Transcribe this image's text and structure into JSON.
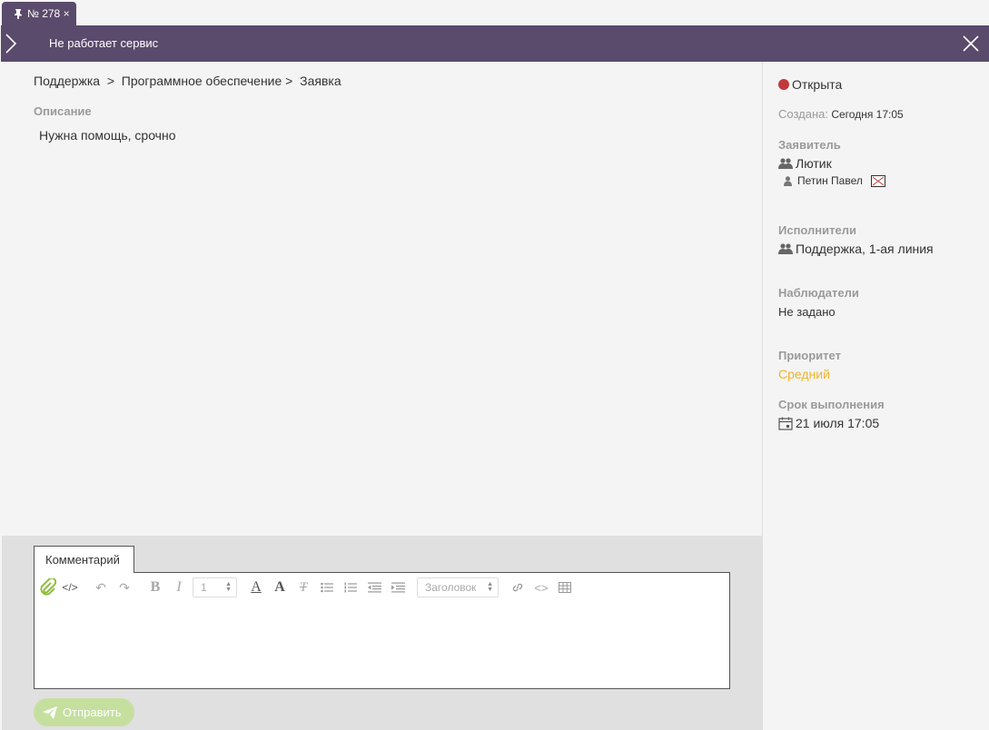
{
  "tab": {
    "label": "№ 278 ×"
  },
  "header": {
    "title": "Не работает сервис"
  },
  "breadcrumb": {
    "items": [
      "Поддержка",
      "  >  ",
      "Программное обеспечение",
      " >  ",
      "Заявка"
    ]
  },
  "description": {
    "label": "Описание",
    "text": "Нужна помощь, срочно"
  },
  "sidebar": {
    "status": "Открыта",
    "status_color": "#c0393b",
    "created_label": "Создана:",
    "created_value": "Сегодня 17:05",
    "applicant_label": "Заявитель",
    "applicant_group": "Лютик",
    "applicant_person": "Петин Павел",
    "executors_label": "Исполнители",
    "executors_group": "Поддержка, 1-ая линия",
    "observers_label": "Наблюдатели",
    "observers_value": "Не задано",
    "priority_label": "Приоритет",
    "priority_value": "Средний",
    "priority_color": "#f0b429",
    "deadline_label": "Срок выполнения",
    "deadline_value": "21 июля 17:05"
  },
  "comment": {
    "tab_label": "Комментарий",
    "font_size_value": "1",
    "heading_select": "Заголовок",
    "send_label": "Отправить"
  }
}
